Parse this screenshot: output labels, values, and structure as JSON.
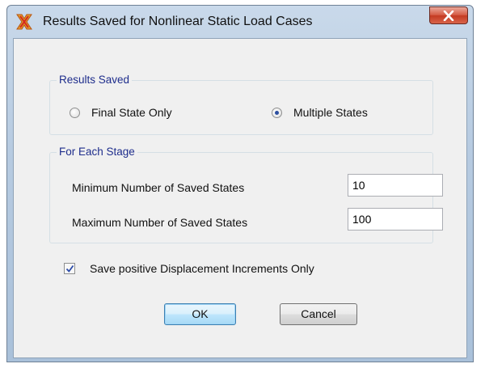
{
  "window": {
    "title": "Results Saved for Nonlinear Static Load Cases"
  },
  "results_saved": {
    "legend": "Results Saved",
    "options": [
      {
        "label": "Final State Only",
        "selected": false
      },
      {
        "label": "Multiple States",
        "selected": true
      }
    ]
  },
  "each_stage": {
    "legend": "For Each Stage",
    "min_label": "Minimum Number of Saved States",
    "min_value": "10",
    "max_label": "Maximum Number of Saved States",
    "max_value": "100"
  },
  "save_positive": {
    "label": "Save positive Displacement Increments Only",
    "checked": true
  },
  "buttons": {
    "ok": "OK",
    "cancel": "Cancel"
  },
  "colors": {
    "legend_text": "#1e2d8c",
    "close_button": "#c43a22"
  },
  "icons": {
    "app": "sap2000-x-icon",
    "close": "close-x-icon",
    "check": "checkmark-icon"
  }
}
